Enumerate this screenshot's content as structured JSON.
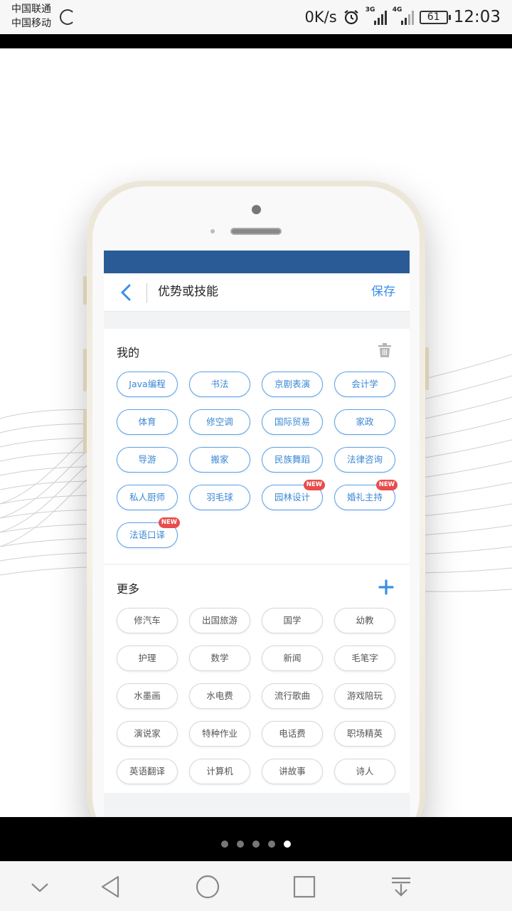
{
  "status_bar": {
    "carrier_1": "中国联通",
    "carrier_2": "中国移动",
    "net_speed": "0K/s",
    "signal_1_tag": "3G",
    "signal_2_tag": "4G",
    "battery": "61",
    "time": "12:03"
  },
  "app": {
    "header_color": "#2a5b96",
    "accent_color": "#3a8ee6",
    "title": "优势或技能",
    "save_label": "保存",
    "mine_section_title": "我的",
    "more_section_title": "更多",
    "mine_tags": [
      {
        "label": "Java编程",
        "new": false
      },
      {
        "label": "书法",
        "new": false
      },
      {
        "label": "京剧表演",
        "new": false
      },
      {
        "label": "会计学",
        "new": false
      },
      {
        "label": "体育",
        "new": false
      },
      {
        "label": "修空调",
        "new": false
      },
      {
        "label": "国际贸易",
        "new": false
      },
      {
        "label": "家政",
        "new": false
      },
      {
        "label": "导游",
        "new": false
      },
      {
        "label": "搬家",
        "new": false
      },
      {
        "label": "民族舞蹈",
        "new": false
      },
      {
        "label": "法律咨询",
        "new": false
      },
      {
        "label": "私人厨师",
        "new": false
      },
      {
        "label": "羽毛球",
        "new": false
      },
      {
        "label": "园林设计",
        "new": true
      },
      {
        "label": "婚礼主持",
        "new": true
      },
      {
        "label": "法语口译",
        "new": true
      }
    ],
    "new_badge": "NEW",
    "more_tags": [
      "修汽车",
      "出国旅游",
      "国学",
      "幼教",
      "护理",
      "数学",
      "新闻",
      "毛笔字",
      "水墨画",
      "水电费",
      "流行歌曲",
      "游戏陪玩",
      "演说家",
      "特种作业",
      "电话费",
      "职场精英",
      "英语翻译",
      "计算机",
      "讲故事",
      "诗人"
    ]
  },
  "carousel": {
    "page_count": 5,
    "active_page": 5
  },
  "icons": {
    "back": "chevron-left-icon",
    "trash": "trash-icon",
    "add": "plus-icon",
    "sys_nav": [
      "chevron-down-icon",
      "back-triangle-icon",
      "home-circle-icon",
      "recents-square-icon",
      "notification-pull-icon"
    ]
  }
}
